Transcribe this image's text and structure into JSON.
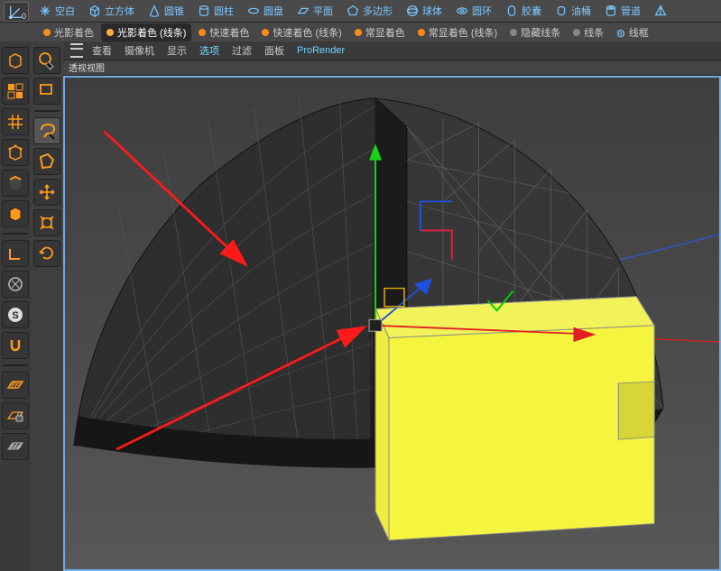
{
  "shelf": {
    "items": [
      {
        "id": "null",
        "label": "空白"
      },
      {
        "id": "cube",
        "label": "立方体"
      },
      {
        "id": "cone",
        "label": "圆锥"
      },
      {
        "id": "cylinder",
        "label": "圆柱"
      },
      {
        "id": "disc",
        "label": "圆盘"
      },
      {
        "id": "plane",
        "label": "平面"
      },
      {
        "id": "polygon",
        "label": "多边形"
      },
      {
        "id": "sphere",
        "label": "球体"
      },
      {
        "id": "torus",
        "label": "圆环"
      },
      {
        "id": "capsule",
        "label": "胶囊"
      },
      {
        "id": "oiltank",
        "label": "油桶"
      },
      {
        "id": "tube",
        "label": "管道"
      },
      {
        "id": "pyramid",
        "label": ""
      }
    ]
  },
  "shading": {
    "items": [
      {
        "label": "光影着色",
        "active": false
      },
      {
        "label": "光影着色 (线条)",
        "active": true
      },
      {
        "label": "快速着色",
        "active": false
      },
      {
        "label": "快速着色 (线条)",
        "active": false
      },
      {
        "label": "常显着色",
        "active": false
      },
      {
        "label": "常显着色 (线条)",
        "active": false
      },
      {
        "label": "隐藏线条",
        "active": false,
        "grey": true
      },
      {
        "label": "线条",
        "active": false,
        "grey": true
      },
      {
        "label": "线框",
        "active": false,
        "grey": true,
        "globe": true
      }
    ]
  },
  "vpmenu": {
    "items": [
      {
        "label": "查看"
      },
      {
        "label": "摄像机"
      },
      {
        "label": "显示"
      },
      {
        "label": "选项",
        "hilite": true
      },
      {
        "label": "过滤"
      },
      {
        "label": "面板"
      },
      {
        "label": "ProRender",
        "hilite": true
      }
    ]
  },
  "vptitle": "透视视图",
  "left1": [
    {
      "id": "make-editable"
    },
    {
      "id": "model"
    },
    {
      "id": "texture"
    },
    {
      "id": "points"
    },
    {
      "id": "edges"
    },
    {
      "id": "polygons"
    },
    {
      "id": "sep"
    },
    {
      "id": "axis"
    },
    {
      "id": "uv"
    },
    {
      "id": "s-mode"
    },
    {
      "id": "snap"
    },
    {
      "id": "sep"
    },
    {
      "id": "wplane"
    },
    {
      "id": "locked"
    },
    {
      "id": "grid"
    }
  ],
  "left2": [
    {
      "id": "select-live"
    },
    {
      "id": "select-rect"
    },
    {
      "id": "sep"
    },
    {
      "id": "lasso"
    },
    {
      "id": "poly-sel"
    },
    {
      "id": "move"
    },
    {
      "id": "scale"
    },
    {
      "id": "rotate"
    }
  ]
}
